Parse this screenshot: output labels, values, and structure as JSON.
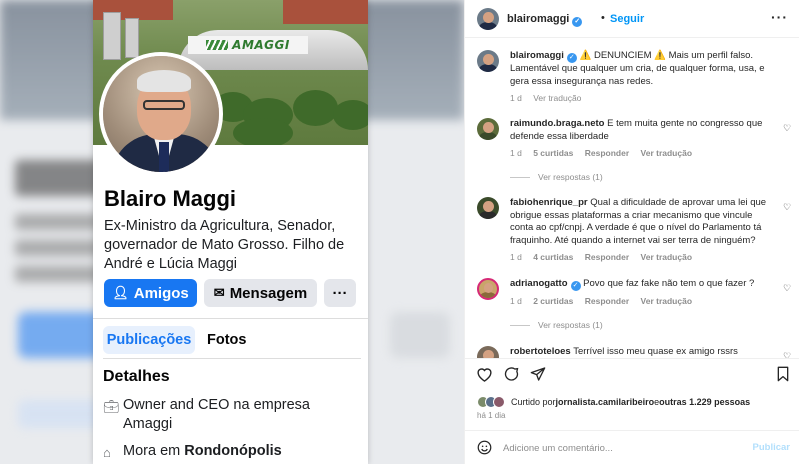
{
  "facebook": {
    "cover_sign": "AMAGGI",
    "name": "Blairo Maggi",
    "bio": "Ex-Ministro da Agricultura, Senador, governador de Mato Grosso. Filho de André e Lúcia Maggi",
    "buttons": {
      "friends": "Amigos",
      "message": "Mensagem",
      "more": "···"
    },
    "tabs": {
      "posts": "Publicações",
      "photos": "Fotos"
    },
    "details_title": "Detalhes",
    "details": {
      "work": "Owner and CEO na empresa Amaggi",
      "home_prefix": "Mora em ",
      "home_city": "Rondonópolis"
    }
  },
  "instagram": {
    "header": {
      "username": "blairomaggi",
      "separator": "•",
      "follow": "Seguir",
      "more": "···"
    },
    "caption": {
      "username": "blairomaggi",
      "text": "⚠️ DENUNCIEM ⚠️ Mais um perfil falso. Lamentável que qualquer um cria, de qualquer forma, usa, e gera essa insegurança nas redes.",
      "time": "1 d",
      "translate": "Ver tradução"
    },
    "comments": [
      {
        "username": "raimundo.braga.neto",
        "text": "E tem muita gente no congresso que defende essa liberdade",
        "time": "1 d",
        "likes": "5 curtidas",
        "reply": "Responder",
        "translate": "Ver tradução",
        "view_replies": "Ver respostas (1)"
      },
      {
        "username": "fabiohenrique_pr",
        "text": "Qual a dificuldade de aprovar uma lei que obrigue essas plataformas a criar mecanismo que vincule conta ao cpf/cnpj. A verdade é que o nível do Parlamento tá fraquinho. Até quando a internet vai ser terra de ninguém?",
        "time": "1 d",
        "likes": "4 curtidas",
        "reply": "Responder",
        "translate": "Ver tradução"
      },
      {
        "username": "adrianogatto",
        "text": "Povo que faz fake não tem o que fazer ?",
        "time": "1 d",
        "likes": "2 curtidas",
        "reply": "Responder",
        "translate": "Ver tradução",
        "view_replies": "Ver respostas (1)"
      },
      {
        "username": "robertoteloes",
        "text": "Terrível isso meu quase ex amigo rssrs"
      }
    ],
    "likes_summary": {
      "prefix": "Curtido por ",
      "user": "jornalista.camilaribeiro",
      "middle": " e ",
      "others": "outras 1.229 pessoas"
    },
    "time_ago": "há 1 dia",
    "comment_box": {
      "placeholder": "Adicione um comentário...",
      "publish": "Publicar"
    },
    "icons": {
      "like": "heart-icon",
      "comment": "comment-icon",
      "share": "share-icon",
      "save": "bookmark-icon",
      "emoji": "emoji-icon"
    },
    "colors": {
      "link": "#0095f6",
      "verified": "#3897f0"
    }
  }
}
